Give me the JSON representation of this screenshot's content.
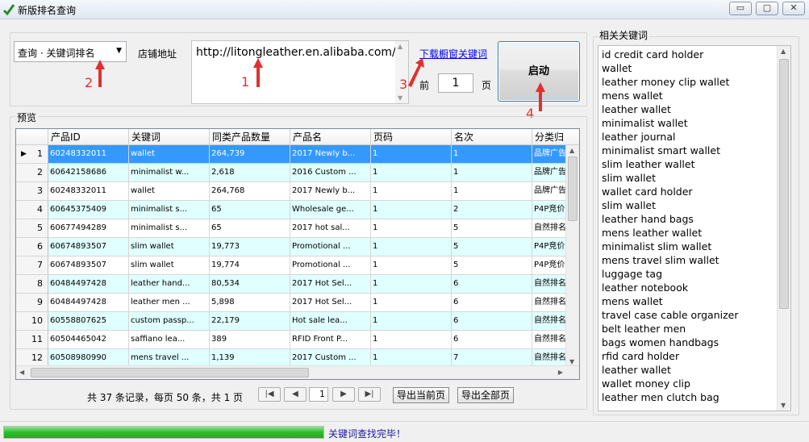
{
  "window": {
    "title": "新版排名查询",
    "controls": [
      "▭",
      "▢",
      "✕"
    ]
  },
  "form": {
    "query_type": "查询 · 关键词排名",
    "shop_label": "店铺地址",
    "shop_url": "http://litongleather.en.alibaba.com/",
    "download_link": "下载橱窗关键词",
    "front_label": "前",
    "page_count": "1",
    "page_label": "页",
    "start_button": "启动"
  },
  "annotations": [
    "1",
    "2",
    "3",
    "4"
  ],
  "preview": {
    "title": "预览",
    "columns": [
      "产品ID",
      "关键词",
      "同类产品数量",
      "产品名",
      "页码",
      "名次",
      "分类归"
    ],
    "rows": [
      {
        "n": "1",
        "id": "60248332011",
        "kw": "wallet",
        "count": "264,739",
        "name": "2017 Newly b...",
        "page": "1",
        "rank": "1",
        "cat": "品牌广告"
      },
      {
        "n": "2",
        "id": "60642158686",
        "kw": "minimalist w...",
        "count": "2,618",
        "name": "2016 Custom ...",
        "page": "1",
        "rank": "1",
        "cat": "品牌广告"
      },
      {
        "n": "3",
        "id": "60248332011",
        "kw": "wallet",
        "count": "264,768",
        "name": "2017 Newly b...",
        "page": "1",
        "rank": "1",
        "cat": "品牌广告"
      },
      {
        "n": "4",
        "id": "60645375409",
        "kw": "minimalist s...",
        "count": "65",
        "name": "Wholesale ge...",
        "page": "1",
        "rank": "2",
        "cat": "P4P竞价"
      },
      {
        "n": "5",
        "id": "60677494289",
        "kw": "minimalist s...",
        "count": "65",
        "name": "2017 hot sal...",
        "page": "1",
        "rank": "5",
        "cat": "自然排名"
      },
      {
        "n": "6",
        "id": "60674893507",
        "kw": "slim wallet",
        "count": "19,773",
        "name": "Promotional ...",
        "page": "1",
        "rank": "5",
        "cat": "P4P竞价"
      },
      {
        "n": "7",
        "id": "60674893507",
        "kw": "slim wallet",
        "count": "19,774",
        "name": "Promotional ...",
        "page": "1",
        "rank": "5",
        "cat": "P4P竞价"
      },
      {
        "n": "8",
        "id": "60484497428",
        "kw": "leather hand...",
        "count": "80,534",
        "name": "2017 Hot Sel...",
        "page": "1",
        "rank": "6",
        "cat": "自然排名"
      },
      {
        "n": "9",
        "id": "60484497428",
        "kw": "leather men ...",
        "count": "5,898",
        "name": "2017 Hot Sel...",
        "page": "1",
        "rank": "6",
        "cat": "自然排名"
      },
      {
        "n": "10",
        "id": "60558807625",
        "kw": "custom passp...",
        "count": "22,179",
        "name": "Hot sale lea...",
        "page": "1",
        "rank": "6",
        "cat": "自然排名"
      },
      {
        "n": "11",
        "id": "60504465042",
        "kw": "saffiano lea...",
        "count": "389",
        "name": "RFID Front P...",
        "page": "1",
        "rank": "6",
        "cat": "自然排名"
      },
      {
        "n": "12",
        "id": "60508980990",
        "kw": "mens travel ...",
        "count": "1,139",
        "name": "2017 Custom ...",
        "page": "1",
        "rank": "7",
        "cat": "自然排名"
      }
    ]
  },
  "pager": {
    "summary": "共 37 条记录，每页 50 条，共 1 页",
    "current_page": "1",
    "export_current": "导出当前页",
    "export_all": "导出全部页"
  },
  "keywords": {
    "title": "相关关键词",
    "items": [
      "id credit card holder",
      "wallet",
      "leather money clip wallet",
      "mens wallet",
      "leather wallet",
      "minimalist wallet",
      "leather journal",
      "minimalist smart wallet",
      "slim leather wallet",
      "slim wallet",
      "wallet card holder",
      "slim wallet",
      "leather hand bags",
      "mens leather wallet",
      "minimalist slim wallet",
      "mens travel slim wallet",
      "luggage tag",
      "leather notebook",
      "mens wallet",
      "travel case cable organizer",
      "belt leather men",
      "bags women handbags",
      "rfid card holder",
      "leather wallet",
      "wallet money clip",
      "leather men clutch bag"
    ]
  },
  "status": {
    "text": "关键词查找完毕！",
    "progress": 1.0
  },
  "colors": {
    "selected_row": "#3399ff",
    "alt_row": "#e0ffff",
    "annotation": "#e03030"
  }
}
